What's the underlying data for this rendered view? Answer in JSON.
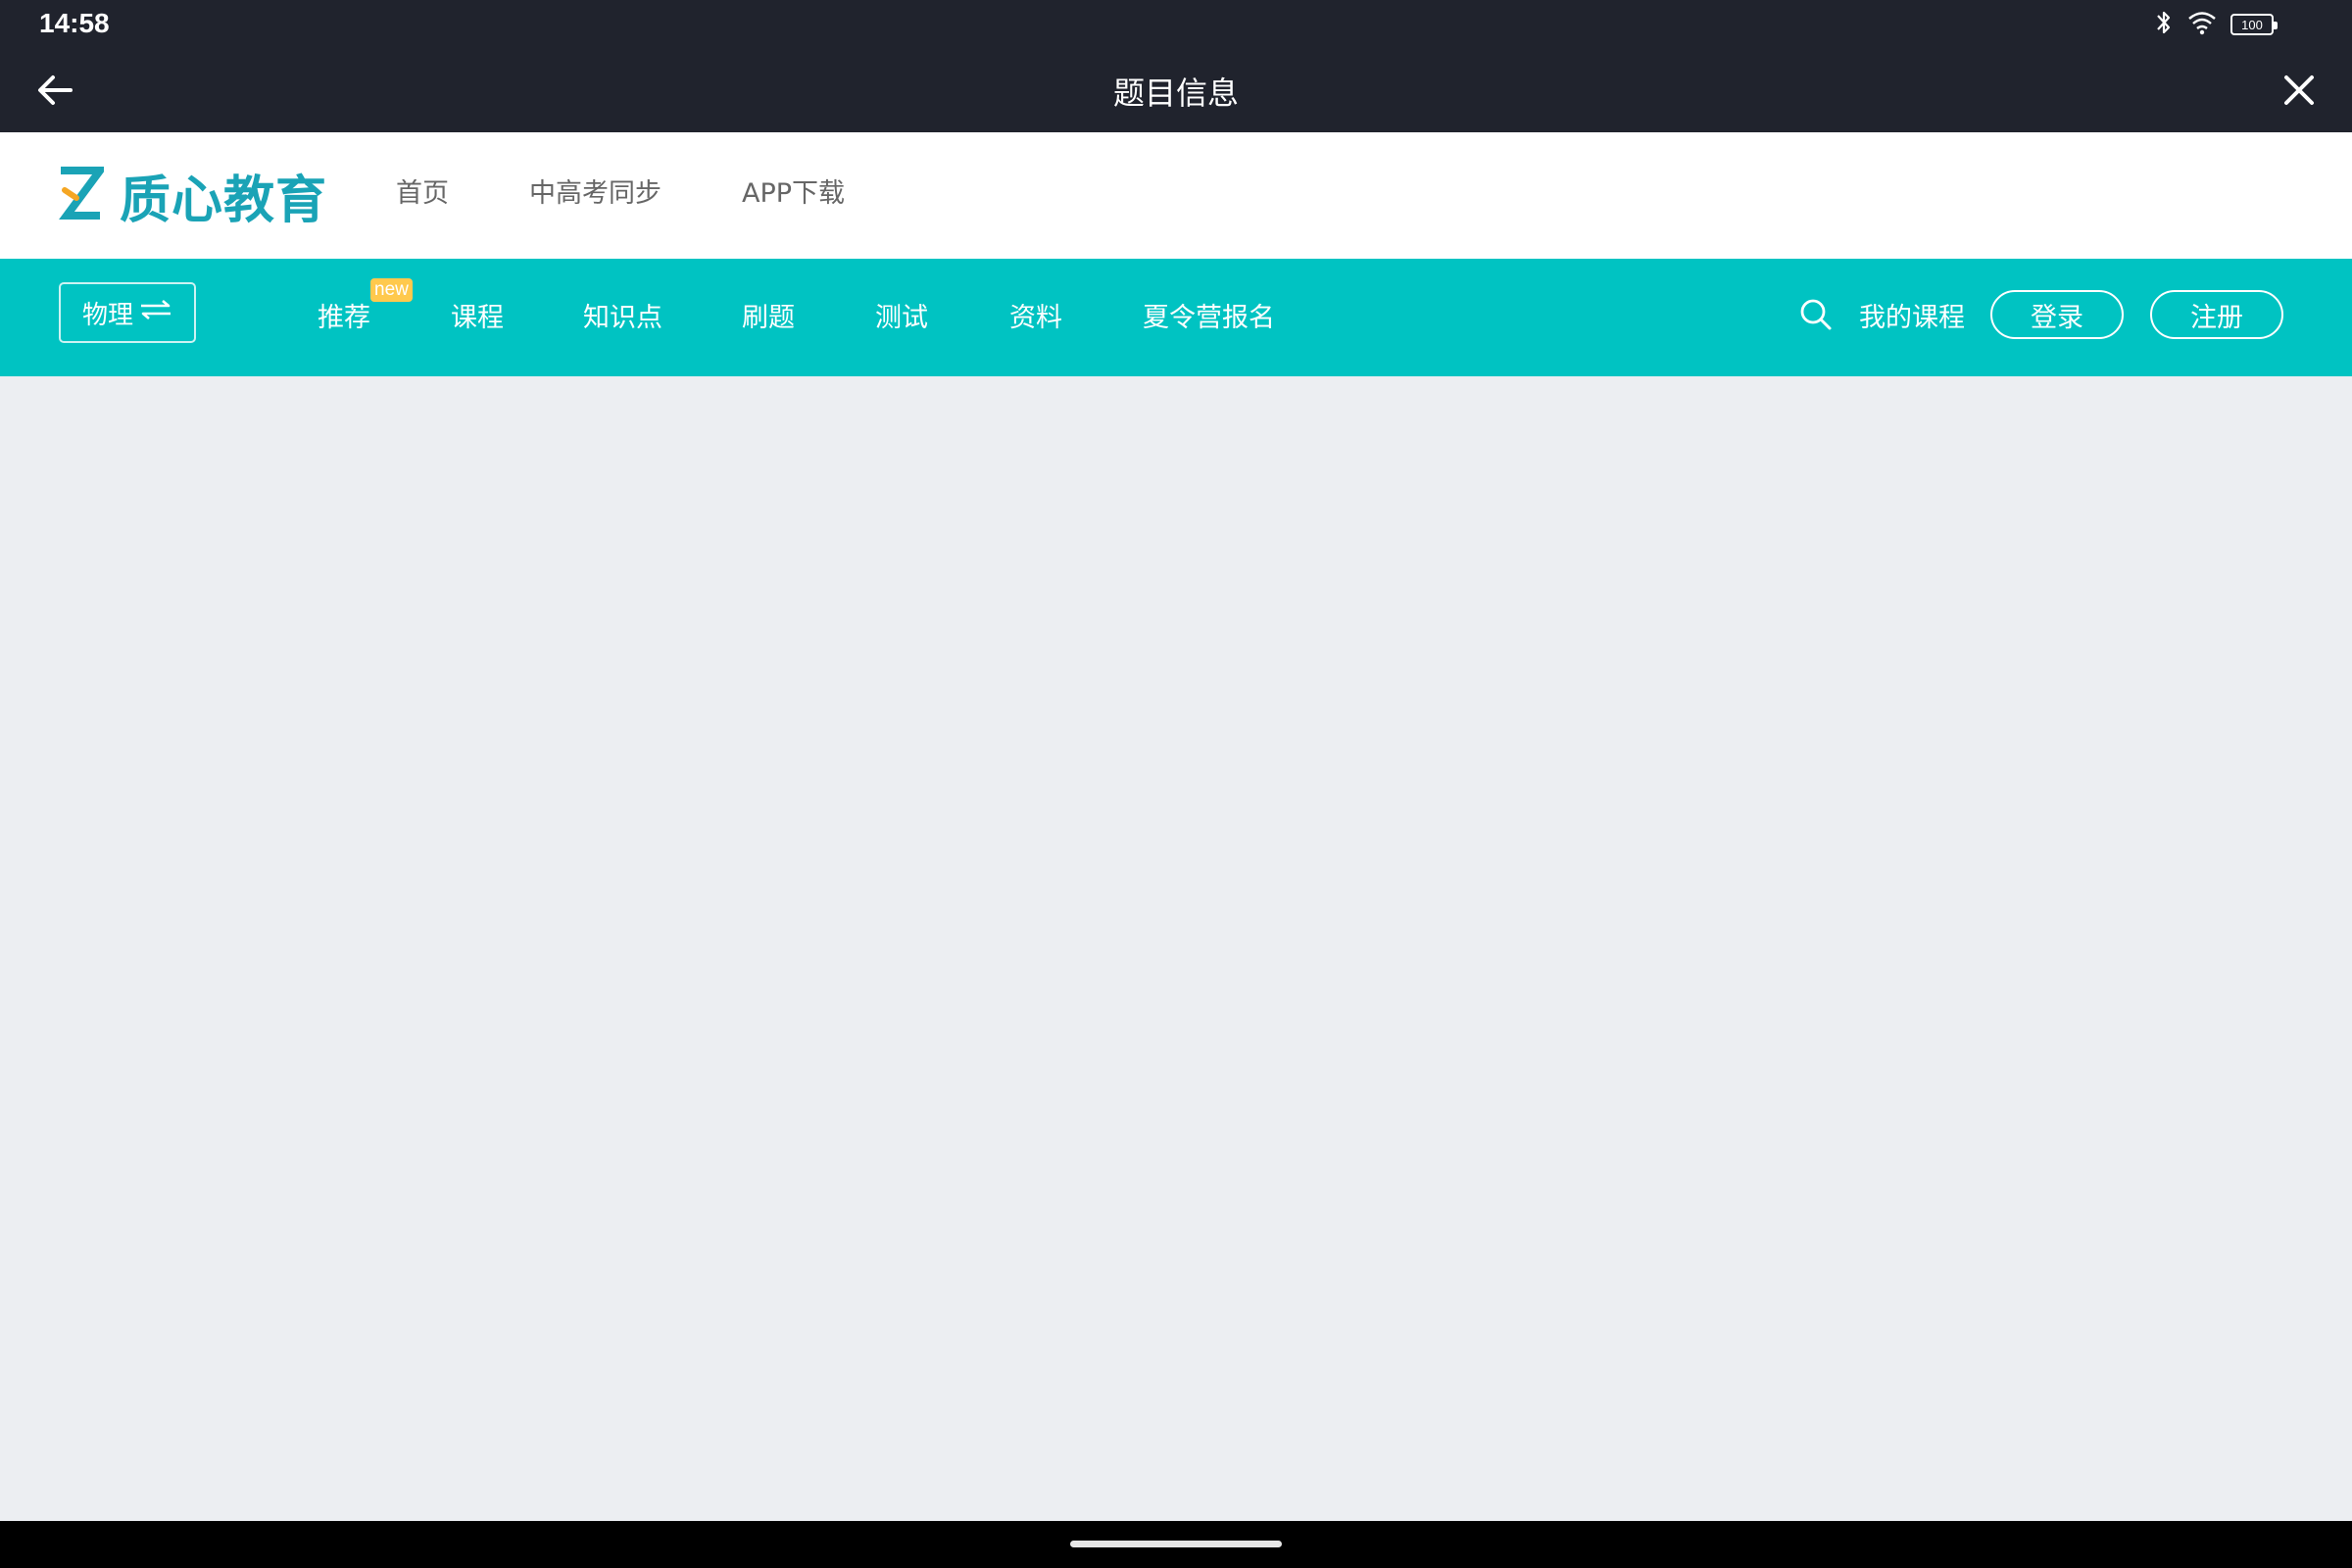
{
  "status_bar": {
    "time": "14:58",
    "battery": "100",
    "icons": [
      "bluetooth-icon",
      "wifi-icon",
      "battery-icon"
    ]
  },
  "title_bar": {
    "title": "题目信息"
  },
  "header": {
    "logo_text": "质心教育",
    "nav": [
      "首页",
      "中高考同步",
      "APP下载"
    ]
  },
  "navbar": {
    "subject": "物理",
    "items": [
      "推荐",
      "课程",
      "知识点",
      "刷题",
      "测试",
      "资料",
      "夏令营报名"
    ],
    "badge": "new",
    "my_course": "我的课程",
    "login": "登录",
    "register": "注册"
  },
  "colors": {
    "teal": "#00c3c2",
    "dark": "#20232d",
    "logo": "#1aa3b6",
    "badge": "#ffc94d",
    "orange": "#f5a623"
  }
}
